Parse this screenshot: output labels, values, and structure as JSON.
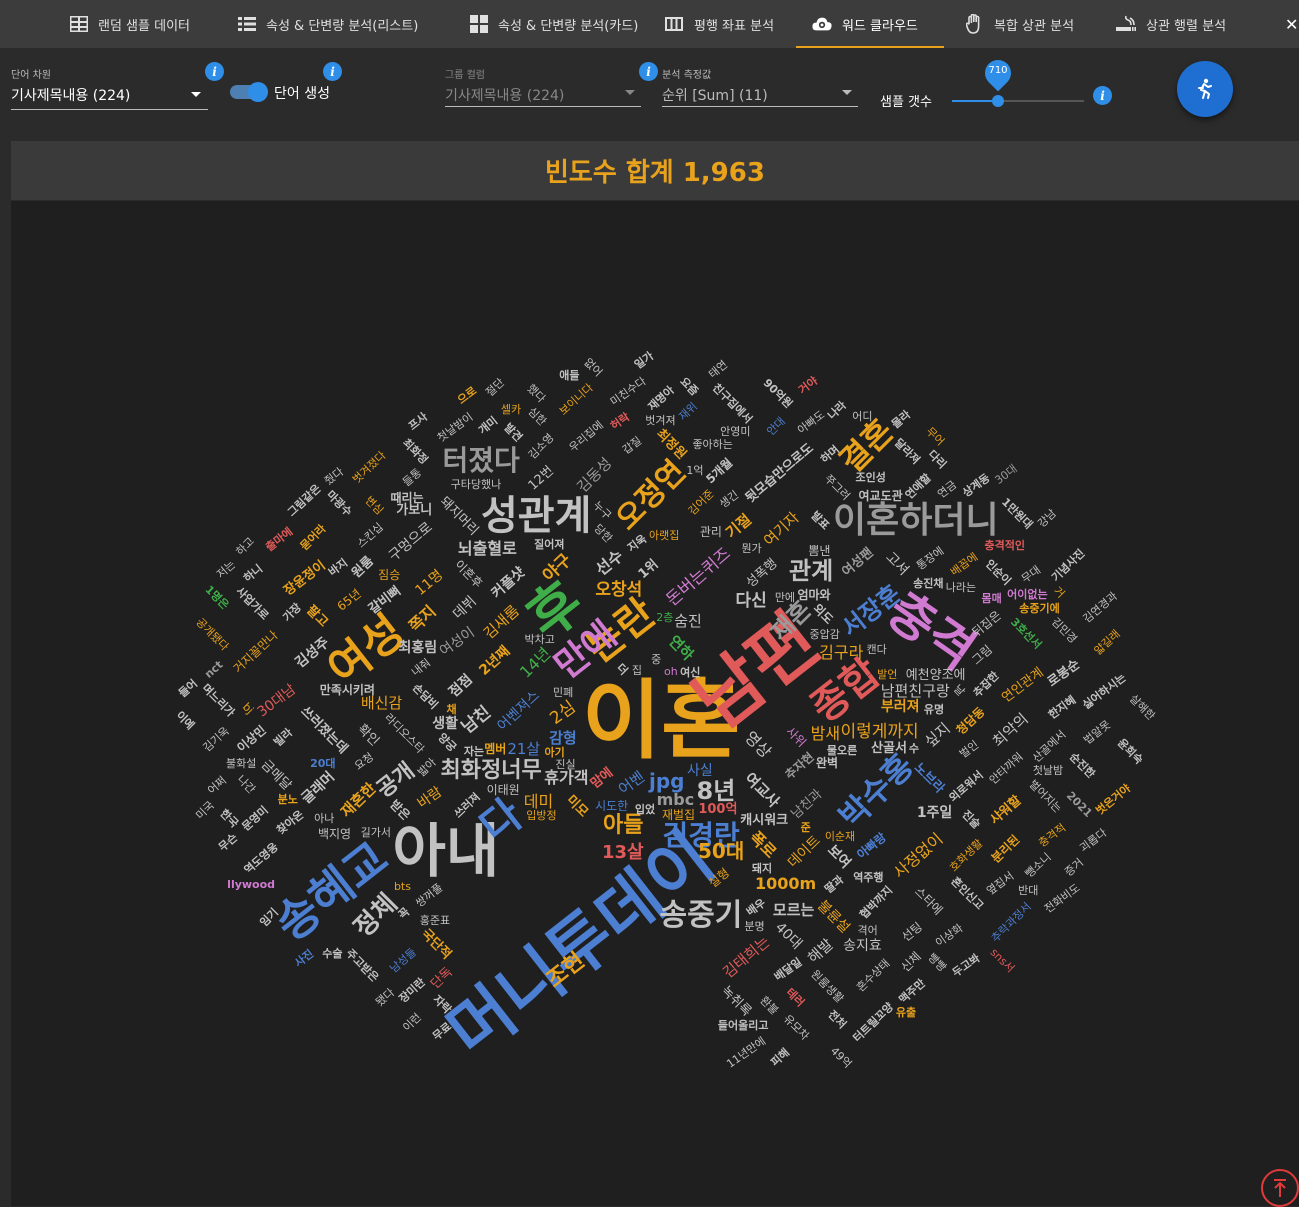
{
  "tabs": [
    {
      "label": "랜덤 샘플 데이터",
      "icon": "table-icon"
    },
    {
      "label": "속성 & 단변량 분석(리스트)",
      "icon": "list-icon"
    },
    {
      "label": "속성 & 단변량 분석(카드)",
      "icon": "grid-icon"
    },
    {
      "label": "평행 좌표 분석",
      "icon": "columns-icon"
    },
    {
      "label": "워드 클라우드",
      "icon": "cloud-icon",
      "active": true
    },
    {
      "label": "복합 상관 분석",
      "icon": "hand-icon"
    },
    {
      "label": "상관 행렬 분석",
      "icon": "smoking-icon"
    }
  ],
  "controls": {
    "word_dim": {
      "label": "단어 차원",
      "value": "기사제목내용 (224)"
    },
    "word_gen": {
      "label": "단어 생성",
      "on": true
    },
    "group_col": {
      "label": "그룹 컬럼",
      "value": "기사제목내용 (224)"
    },
    "measure": {
      "label": "분석 측정값",
      "value": "순위 [Sum] (11)"
    },
    "sample": {
      "label": "샘플 갯수",
      "value": "710",
      "fraction": 0.35
    }
  },
  "panel": {
    "title": "빈도수 합계 1,963"
  },
  "colors": {
    "accent": "#e8a21c",
    "primary": "#2f8ee8"
  },
  "cloud_words": [
    {
      "t": "이혼",
      "c": "#e8a21c"
    },
    {
      "t": "남편",
      "c": "#e05a5a"
    },
    {
      "t": "머니투데이",
      "c": "#4c7fd1"
    },
    {
      "t": "아내",
      "c": "#c2c2c2"
    },
    {
      "t": "송혜교",
      "c": "#4c7fd1"
    },
    {
      "t": "후",
      "c": "#3fae49"
    },
    {
      "t": "충격",
      "c": "#d17ad1"
    },
    {
      "t": "성관계",
      "c": "#c2c2c2"
    },
    {
      "t": "여성",
      "c": "#e8a21c"
    },
    {
      "t": "논란",
      "c": "#e8a21c"
    },
    {
      "t": "만에",
      "c": "#d17ad1"
    },
    {
      "t": "종합",
      "c": "#e05a5a"
    },
    {
      "t": "이혼하더니",
      "c": "#9a9a9a"
    },
    {
      "t": "결혼",
      "c": "#e8a21c"
    },
    {
      "t": "공개",
      "c": "#c2c2c2"
    },
    {
      "t": "오정연",
      "c": "#e8a21c"
    },
    {
      "t": "터졌다",
      "c": "#9a9a9a"
    },
    {
      "t": "김경란",
      "c": "#4c7fd1"
    },
    {
      "t": "송중기",
      "c": "#c2c2c2"
    },
    {
      "t": "박수홍",
      "c": "#4c7fd1"
    },
    {
      "t": "다",
      "c": "#4c7fd1"
    },
    {
      "t": "정체",
      "c": "#c2c2c2"
    },
    {
      "t": "조현",
      "c": "#e8a21c"
    },
    {
      "t": "서장훈",
      "c": "#4c7fd1"
    },
    {
      "t": "관계",
      "c": "#c2c2c2"
    },
    {
      "t": "재혼",
      "c": "#9a9a9a"
    },
    {
      "t": "최화정너무",
      "c": "#c2c2c2"
    },
    {
      "t": "아들",
      "c": "#e8a21c"
    },
    {
      "t": "8년",
      "c": "#c2c2c2"
    },
    {
      "t": "50대",
      "c": "#e8a21c"
    },
    {
      "t": "13살",
      "c": "#e05a5a"
    },
    {
      "t": "jpg",
      "c": "#4c7fd1"
    },
    {
      "t": "연하",
      "c": "#3fae49"
    },
    {
      "t": "어벤",
      "c": "#4c7fd1"
    },
    {
      "t": "mbc",
      "c": "#9a9a9a"
    },
    {
      "t": "영상",
      "c": "#c2c2c2"
    },
    {
      "t": "2심",
      "c": "#e8a21c"
    },
    {
      "t": "여교사",
      "c": "#c2c2c2"
    },
    {
      "t": "어벤져스",
      "c": "#4c7fd1"
    },
    {
      "t": "휴가객",
      "c": "#c2c2c2"
    },
    {
      "t": "14년",
      "c": "#3fae49"
    },
    {
      "t": "사위",
      "c": "#d17ad1"
    },
    {
      "t": "미모",
      "c": "#e8a21c"
    },
    {
      "t": "돈버는퀴즈",
      "c": "#d17ad1"
    },
    {
      "t": "추자현",
      "c": "#9a9a9a"
    },
    {
      "t": "캐시워크",
      "c": "#c2c2c2"
    },
    {
      "t": "남친과",
      "c": "#9a9a9a"
    },
    {
      "t": "시도한",
      "c": "#4c7fd1"
    },
    {
      "t": "2년째",
      "c": "#e8a21c"
    },
    {
      "t": "감형",
      "c": "#4c7fd1"
    },
    {
      "t": "남친",
      "c": "#c2c2c2"
    },
    {
      "t": "집",
      "c": "#c2c2c2"
    },
    {
      "t": "오창석",
      "c": "#e8a21c"
    },
    {
      "t": "데미",
      "c": "#e8a21c"
    },
    {
      "t": "폭로",
      "c": "#e8a21c"
    },
    {
      "t": "이렇게까지",
      "c": "#e8a21c"
    },
    {
      "t": "점점",
      "c": "#c2c2c2"
    },
    {
      "t": "김새롬",
      "c": "#e8a21c"
    },
    {
      "t": "선수",
      "c": "#c2c2c2"
    },
    {
      "t": "다신",
      "c": "#c2c2c2"
    },
    {
      "t": "사실",
      "c": "#4c7fd1"
    },
    {
      "t": "1위",
      "c": "#c2c2c2"
    },
    {
      "t": "야구",
      "c": "#e8a21c"
    },
    {
      "t": "성폭행",
      "c": "#c2c2c2"
    },
    {
      "t": "데이트",
      "c": "#e8a21c"
    },
    {
      "t": "생활",
      "c": "#c2c2c2"
    },
    {
      "t": "실형",
      "c": "#e8a21c"
    },
    {
      "t": "민폐",
      "c": "#c2c2c2"
    },
    {
      "t": "여성이",
      "c": "#9a9a9a"
    },
    {
      "t": "21살",
      "c": "#4c7fd1"
    },
    {
      "t": "외도",
      "c": "#c2c2c2"
    },
    {
      "t": "라디오스타",
      "c": "#c2c2c2"
    },
    {
      "t": "1000m",
      "c": "#e8a21c"
    },
    {
      "t": "커플샷",
      "c": "#c2c2c2"
    },
    {
      "t": "남편친구랑",
      "c": "#c2c2c2"
    },
    {
      "t": "보여",
      "c": "#c2c2c2"
    },
    {
      "t": "손담비",
      "c": "#c2c2c2"
    },
    {
      "t": "기절",
      "c": "#e8a21c"
    },
    {
      "t": "김구라",
      "c": "#e8a21c"
    },
    {
      "t": "쪽지",
      "c": "#e8a21c"
    },
    {
      "t": "뇌출혈로",
      "c": "#c2c2c2"
    },
    {
      "t": "여기자",
      "c": "#e8a21c"
    },
    {
      "t": "숨진",
      "c": "#c2c2c2"
    },
    {
      "t": "아기",
      "c": "#e8a21c"
    },
    {
      "t": "밤새",
      "c": "#e8a21c"
    },
    {
      "t": "데뷔",
      "c": "#c2c2c2"
    },
    {
      "t": "이혼후",
      "c": "#c2c2c2"
    },
    {
      "t": "멤버",
      "c": "#e8a21c"
    },
    {
      "t": "노브라",
      "c": "#4c7fd1"
    },
    {
      "t": "재벌집",
      "c": "#e8a21c"
    },
    {
      "t": "사정없이",
      "c": "#e8a21c"
    },
    {
      "t": "지욱",
      "c": "#c2c2c2"
    },
    {
      "t": "쓰러져",
      "c": "#c2c2c2"
    },
    {
      "t": "바람",
      "c": "#e8a21c"
    },
    {
      "t": "여성팬",
      "c": "#9a9a9a"
    },
    {
      "t": "11명",
      "c": "#e8a21c"
    },
    {
      "t": "100억",
      "c": "#e05a5a"
    },
    {
      "t": "확인",
      "c": "#c2c2c2"
    },
    {
      "t": "싶지",
      "c": "#c2c2c2"
    },
    {
      "t": "김어준",
      "c": "#e8a21c"
    },
    {
      "t": "입방정",
      "c": "#e8a21c"
    },
    {
      "t": "불륜설",
      "c": "#e8a21c"
    },
    {
      "t": "최홍림",
      "c": "#c2c2c2"
    },
    {
      "t": "청담동",
      "c": "#e8a21c"
    },
    {
      "t": "김태희는",
      "c": "#e05a5a"
    },
    {
      "t": "외로워서",
      "c": "#c2c2c2"
    },
    {
      "t": "재혼한",
      "c": "#e8a21c"
    },
    {
      "t": "갈비뼈",
      "c": "#c2c2c2"
    },
    {
      "t": "이순재",
      "c": "#e8a21c"
    },
    {
      "t": "고셔",
      "c": "#c2c2c2"
    },
    {
      "t": "쓰러졌는데",
      "c": "#c2c2c2"
    },
    {
      "t": "부러져",
      "c": "#e8a21c"
    },
    {
      "t": "모르는",
      "c": "#c2c2c2"
    },
    {
      "t": "구멍으로",
      "c": "#c2c2c2"
    },
    {
      "t": "배신감",
      "c": "#e8a21c"
    },
    {
      "t": "쌍꺼풀",
      "c": "#c2c2c2"
    },
    {
      "t": "질어져",
      "c": "#c2c2c2"
    },
    {
      "t": "예천양조에",
      "c": "#c2c2c2"
    },
    {
      "t": "돼지머리",
      "c": "#c2c2c2"
    },
    {
      "t": "아빠랑",
      "c": "#4c7fd1"
    },
    {
      "t": "뒷모습만으로도",
      "c": "#c2c2c2"
    },
    {
      "t": "양궁",
      "c": "#c2c2c2"
    },
    {
      "t": "1주일",
      "c": "#c2c2c2"
    },
    {
      "t": "김동성",
      "c": "#9a9a9a"
    },
    {
      "t": "추잡한",
      "c": "#c2c2c2"
    },
    {
      "t": "협박까지",
      "c": "#c2c2c2"
    },
    {
      "t": "5개월",
      "c": "#c2c2c2"
    },
    {
      "t": "뒤집은",
      "c": "#c2c2c2"
    },
    {
      "t": "통장에",
      "c": "#c2c2c2"
    },
    {
      "t": "최악의",
      "c": "#c2c2c2"
    },
    {
      "t": "이태원",
      "c": "#c2c2c2"
    },
    {
      "t": "40대",
      "c": "#c2c2c2"
    },
    {
      "t": "12번",
      "c": "#c2c2c2"
    },
    {
      "t": "해발",
      "c": "#c2c2c2"
    },
    {
      "t": "안타까워",
      "c": "#c2c2c2"
    },
    {
      "t": "쭈그려",
      "c": "#c2c2c2"
    },
    {
      "t": "중압감",
      "c": "#c2c2c2"
    },
    {
      "t": "발표",
      "c": "#c2c2c2"
    },
    {
      "t": "샤워할",
      "c": "#e8a21c"
    },
    {
      "t": "글래머",
      "c": "#c2c2c2"
    },
    {
      "t": "맘에",
      "c": "#e05a5a"
    },
    {
      "t": "김성주",
      "c": "#c2c2c2"
    },
    {
      "t": "송지효",
      "c": "#c2c2c2"
    },
    {
      "t": "스타에",
      "c": "#c2c2c2"
    },
    {
      "t": "팔고",
      "c": "#e8a21c"
    },
    {
      "t": "갑질",
      "c": "#c2c2c2"
    },
    {
      "t": "관리",
      "c": "#c2c2c2"
    },
    {
      "t": "배꼽에",
      "c": "#e8a21c"
    },
    {
      "t": "밟아",
      "c": "#c2c2c2"
    },
    {
      "t": "호화생활",
      "c": "#e8a21c"
    },
    {
      "t": "3호선서",
      "c": "#3fae49"
    },
    {
      "t": "30대남",
      "c": "#e05a5a"
    },
    {
      "t": "만족시키려",
      "c": "#c2c2c2"
    },
    {
      "t": "연인관계",
      "c": "#e8a21c"
    },
    {
      "t": "국단적",
      "c": "#e8a21c"
    },
    {
      "t": "진실",
      "c": "#c2c2c2"
    },
    {
      "t": "원룸",
      "c": "#c2c2c2"
    },
    {
      "t": "최정원",
      "c": "#e8a21c"
    },
    {
      "t": "65년",
      "c": "#e8a21c"
    },
    {
      "t": "녹취록",
      "c": "#c2c2c2"
    },
    {
      "t": "선팅",
      "c": "#c2c2c2"
    },
    {
      "t": "산골에서",
      "c": "#c2c2c2"
    },
    {
      "t": "박차고",
      "c": "#c2c2c2"
    },
    {
      "t": "요청",
      "c": "#c2c2c2"
    },
    {
      "t": "원룸생활",
      "c": "#c2c2c2"
    },
    {
      "t": "백지영",
      "c": "#c2c2c2"
    },
    {
      "t": "분리된",
      "c": "#e8a21c"
    },
    {
      "t": "구타당했나",
      "c": "#c2c2c2"
    },
    {
      "t": "물오른",
      "c": "#c2c2c2"
    },
    {
      "t": "금메달",
      "c": "#c2c2c2"
    },
    {
      "t": "산골서",
      "c": "#c2c2c2"
    },
    {
      "t": "혼인신고",
      "c": "#c2c2c2"
    },
    {
      "t": "우리집에",
      "c": "#c2c2c2"
    },
    {
      "t": "벌인",
      "c": "#c2c2c2"
    },
    {
      "t": "장윤정이",
      "c": "#e8a21c"
    },
    {
      "t": "여교도관",
      "c": "#c2c2c2"
    },
    {
      "t": "엄마와",
      "c": "#c2c2c2"
    },
    {
      "t": "가보니",
      "c": "#c2c2c2"
    },
    {
      "t": "인순이",
      "c": "#c2c2c2"
    },
    {
      "t": "받은",
      "c": "#c2c2c2"
    },
    {
      "t": "완벽",
      "c": "#c2c2c2"
    },
    {
      "t": "배우",
      "c": "#c2c2c2"
    },
    {
      "t": "내줘",
      "c": "#c2c2c2"
    },
    {
      "t": "좋아하는",
      "c": "#c2c2c2"
    },
    {
      "t": "혼수상태",
      "c": "#c2c2c2"
    },
    {
      "t": "스킨십",
      "c": "#c2c2c2"
    },
    {
      "t": "남성들",
      "c": "#4c7fd1"
    },
    {
      "t": "뽐낸",
      "c": "#c2c2c2"
    },
    {
      "t": "누구",
      "c": "#c2c2c2"
    },
    {
      "t": "딸과",
      "c": "#c2c2c2"
    },
    {
      "t": "찾아온",
      "c": "#c2c2c2"
    },
    {
      "t": "연애할",
      "c": "#c2c2c2"
    },
    {
      "t": "안영미",
      "c": "#c2c2c2"
    },
    {
      "t": "그림",
      "c": "#c2c2c2"
    },
    {
      "t": "때리는",
      "c": "#c2c2c2"
    },
    {
      "t": "아랫집",
      "c": "#e8a21c"
    },
    {
      "t": "캔다",
      "c": "#c2c2c2"
    },
    {
      "t": "테러",
      "c": "#e05a5a"
    },
    {
      "t": "김소영",
      "c": "#c2c2c2"
    },
    {
      "t": "허락",
      "c": "#e05a5a"
    },
    {
      "t": "단독",
      "c": "#e05a5a"
    },
    {
      "t": "벌어지는",
      "c": "#c2c2c2"
    },
    {
      "t": "배달일",
      "c": "#c2c2c2"
    },
    {
      "t": "여신",
      "c": "#c2c2c2"
    },
    {
      "t": "이상화",
      "c": "#c2c2c2"
    },
    {
      "t": "로봉순",
      "c": "#c2c2c2"
    },
    {
      "t": "거지꼴만나",
      "c": "#e8a21c"
    },
    {
      "t": "옆집서",
      "c": "#c2c2c2"
    },
    {
      "t": "벗겨져",
      "c": "#c2c2c2"
    },
    {
      "t": "발견",
      "c": "#c2c2c2"
    },
    {
      "t": "돼지",
      "c": "#c2c2c2"
    },
    {
      "t": "신체",
      "c": "#c2c2c2"
    },
    {
      "t": "진술",
      "c": "#c2c2c2"
    },
    {
      "t": "안대",
      "c": "#4c7fd1"
    },
    {
      "t": "빌라",
      "c": "#c2c2c2"
    },
    {
      "t": "생긴",
      "c": "#c2c2c2"
    },
    {
      "t": "들통",
      "c": "#c2c2c2"
    },
    {
      "t": "무대",
      "c": "#c2c2c2"
    },
    {
      "t": "이상민",
      "c": "#c2c2c2"
    },
    {
      "t": "환불",
      "c": "#c2c2c2"
    },
    {
      "t": "아빠도",
      "c": "#c2c2c2"
    },
    {
      "t": "심한",
      "c": "#c2c2c2"
    },
    {
      "t": "발언",
      "c": "#e8a21c"
    },
    {
      "t": "변심",
      "c": "#e8a21c"
    },
    {
      "t": "재위",
      "c": "#4c7fd1"
    },
    {
      "t": "순진한",
      "c": "#c2c2c2"
    },
    {
      "t": "묻어라",
      "c": "#e8a21c"
    },
    {
      "t": "친구집에서",
      "c": "#c2c2c2"
    },
    {
      "t": "재명아",
      "c": "#c2c2c2"
    },
    {
      "t": "어이없는",
      "c": "#d17ad1"
    },
    {
      "t": "길가서",
      "c": "#c2c2c2"
    },
    {
      "t": "유모차",
      "c": "#c2c2c2"
    },
    {
      "t": "연금",
      "c": "#c2c2c2"
    },
    {
      "t": "송중기에",
      "c": "#e8a21c"
    },
    {
      "t": "한지혜",
      "c": "#c2c2c2"
    },
    {
      "t": "충격적인",
      "c": "#e05a5a"
    },
    {
      "t": "충격적",
      "c": "#e8a21c"
    },
    {
      "t": "짐승",
      "c": "#e8a21c"
    },
    {
      "t": "조인성",
      "c": "#c2c2c2"
    },
    {
      "t": "들어올리고",
      "c": "#c2c2c2"
    },
    {
      "t": "싫어하시는",
      "c": "#c2c2c2"
    },
    {
      "t": "2021",
      "c": "#9a9a9a"
    },
    {
      "t": "빵빵",
      "c": "#c2c2c2"
    },
    {
      "t": "나간",
      "c": "#c2c2c2"
    },
    {
      "t": "김민경",
      "c": "#c2c2c2"
    },
    {
      "t": "보이니다",
      "c": "#e8a21c"
    },
    {
      "t": "첫날밤",
      "c": "#c2c2c2"
    },
    {
      "t": "분명",
      "c": "#c2c2c2"
    },
    {
      "t": "최화정",
      "c": "#c2c2c2"
    },
    {
      "t": "문영미",
      "c": "#c2c2c2"
    },
    {
      "t": "추락과정서",
      "c": "#4c7fd1"
    },
    {
      "t": "주고받은",
      "c": "#c2c2c2"
    },
    {
      "t": "사업가로",
      "c": "#c2c2c2"
    },
    {
      "t": "맥주만",
      "c": "#c2c2c2"
    },
    {
      "t": "11년만에",
      "c": "#c2c2c2"
    },
    {
      "t": "역도영웅",
      "c": "#c2c2c2"
    },
    {
      "t": "마광수",
      "c": "#c2c2c2"
    },
    {
      "t": "첫날밤이",
      "c": "#c2c2c2"
    },
    {
      "t": "터트릴꼬양",
      "c": "#c2c2c2"
    },
    {
      "t": "뺑소니",
      "c": "#c2c2c2"
    },
    {
      "t": "불화설",
      "c": "#c2c2c2"
    },
    {
      "t": "며느리가",
      "c": "#c2c2c2"
    },
    {
      "t": "미친수다",
      "c": "#c2c2c2"
    },
    {
      "t": "벗겨졌다",
      "c": "#e8a21c"
    },
    {
      "t": "상계동",
      "c": "#c2c2c2"
    },
    {
      "t": "자락",
      "c": "#c2c2c2"
    },
    {
      "t": "출마에",
      "c": "#e05a5a"
    },
    {
      "t": "달라져",
      "c": "#c2c2c2"
    },
    {
      "t": "장미란",
      "c": "#c2c2c2"
    },
    {
      "t": "역주행",
      "c": "#c2c2c2"
    },
    {
      "t": "송진채",
      "c": "#c2c2c2"
    },
    {
      "t": "가장",
      "c": "#c2c2c2"
    },
    {
      "t": "1만원대",
      "c": "#c2c2c2"
    },
    {
      "t": "나라는",
      "c": "#c2c2c2"
    },
    {
      "t": "법알못",
      "c": "#c2c2c2"
    },
    {
      "t": "기념사진",
      "c": "#c2c2c2"
    },
    {
      "t": "김기욱",
      "c": "#c2c2c2"
    },
    {
      "t": "그림같은",
      "c": "#c2c2c2"
    },
    {
      "t": "홍준표",
      "c": "#c2c2c2"
    },
    {
      "t": "90억원",
      "c": "#c2c2c2"
    },
    {
      "t": "괴롭다",
      "c": "#c2c2c2"
    },
    {
      "t": "두고봐",
      "c": "#c2c2c2"
    },
    {
      "t": "한국",
      "c": "#c2c2c2"
    },
    {
      "t": "김연경과",
      "c": "#c2c2c2"
    },
    {
      "t": "나라",
      "c": "#c2c2c2"
    },
    {
      "t": "sns서",
      "c": "#e05a5a"
    },
    {
      "t": "하며",
      "c": "#c2c2c2"
    },
    {
      "t": "윤희숙",
      "c": "#c2c2c2"
    },
    {
      "t": "하니",
      "c": "#c2c2c2"
    },
    {
      "t": "아나",
      "c": "#c2c2c2"
    },
    {
      "t": "요즘",
      "c": "#c2c2c2"
    },
    {
      "t": "전처",
      "c": "#c2c2c2"
    },
    {
      "t": "했다",
      "c": "#c2c2c2"
    },
    {
      "t": "당한",
      "c": "#c2c2c2"
    },
    {
      "t": "증거",
      "c": "#c2c2c2"
    },
    {
      "t": "공개됐다",
      "c": "#e8a21c"
    },
    {
      "t": "피해",
      "c": "#c2c2c2"
    },
    {
      "t": "어디",
      "c": "#c2c2c2"
    },
    {
      "t": "수술",
      "c": "#c2c2c2"
    },
    {
      "t": "프사",
      "c": "#c2c2c2"
    },
    {
      "t": "날",
      "c": "#c2c2c2"
    },
    {
      "t": "줬다",
      "c": "#c2c2c2"
    },
    {
      "t": "자는",
      "c": "#c2c2c2"
    },
    {
      "t": "거",
      "c": "#e8a21c"
    },
    {
      "t": "무슨",
      "c": "#c2c2c2"
    },
    {
      "t": "몰라",
      "c": "#c2c2c2"
    },
    {
      "t": "개미",
      "c": "#c2c2c2"
    },
    {
      "t": "다리",
      "c": "#c2c2c2"
    },
    {
      "t": "이런",
      "c": "#c2c2c2"
    },
    {
      "t": "미국",
      "c": "#c2c2c2"
    },
    {
      "t": "태연",
      "c": "#c2c2c2"
    },
    {
      "t": "없어",
      "c": "#c2c2c2"
    },
    {
      "t": "들어",
      "c": "#c2c2c2"
    },
    {
      "t": "반대",
      "c": "#c2c2c2"
    },
    {
      "t": "만에",
      "c": "#c2c2c2"
    },
    {
      "t": "1억",
      "c": "#c2c2c2"
    },
    {
      "t": "더",
      "c": "#c2c2c2"
    },
    {
      "t": "격어",
      "c": "#c2c2c2"
    },
    {
      "t": "얇길래",
      "c": "#e8a21c"
    },
    {
      "t": "분노",
      "c": "#e8a21c"
    },
    {
      "t": "벗은거야",
      "c": "#e8a21c"
    },
    {
      "t": "30대",
      "c": "#9a9a9a"
    },
    {
      "t": "유출",
      "c": "#e8a21c"
    },
    {
      "t": "바지",
      "c": "#c2c2c2"
    },
    {
      "t": "유명",
      "c": "#c2c2c2"
    },
    {
      "t": "무료",
      "c": "#c2c2c2"
    },
    {
      "t": "20대",
      "c": "#4c7fd1"
    },
    {
      "t": "채",
      "c": "#e8a21c"
    },
    {
      "t": "입었",
      "c": "#c2c2c2"
    },
    {
      "t": "1명은",
      "c": "#3fae49"
    },
    {
      "t": "됐다",
      "c": "#c2c2c2"
    },
    {
      "t": "몸매",
      "c": "#d17ad1"
    },
    {
      "t": "nct",
      "c": "#9a9a9a"
    },
    {
      "t": "어쩌",
      "c": "#c2c2c2"
    },
    {
      "t": "oh",
      "c": "#d17ad1"
    },
    {
      "t": "수",
      "c": "#c2c2c2"
    },
    {
      "t": "강남",
      "c": "#c2c2c2"
    },
    {
      "t": "으로",
      "c": "#e8a21c"
    },
    {
      "t": "준",
      "c": "#e8a21c"
    },
    {
      "t": "꼭",
      "c": "#c2c2c2"
    },
    {
      "t": "뭔가",
      "c": "#c2c2c2"
    },
    {
      "t": "무어",
      "c": "#e8a21c"
    },
    {
      "t": "중",
      "c": "#c2c2c2"
    },
    {
      "t": "llywood",
      "c": "#d17ad1"
    },
    {
      "t": "사진",
      "c": "#4c7fd1"
    },
    {
      "t": "셀카",
      "c": "#e8a21c"
    },
    {
      "t": "임기",
      "c": "#c2c2c2"
    },
    {
      "t": "일가",
      "c": "#c2c2c2"
    },
    {
      "t": "49억",
      "c": "#c2c2c2"
    },
    {
      "t": "이예",
      "c": "#c2c2c2"
    },
    {
      "t": "bts",
      "c": "#e8a21c"
    },
    {
      "t": "bj",
      "c": "#e8a21c"
    },
    {
      "t": "2층",
      "c": "#3fae49"
    },
    {
      "t": "저는",
      "c": "#c2c2c2"
    },
    {
      "t": "전화비도",
      "c": "#c2c2c2"
    },
    {
      "t": "애들",
      "c": "#c2c2c2"
    },
    {
      "t": "거야",
      "c": "#e05a5a"
    },
    {
      "t": "하고",
      "c": "#c2c2c2"
    },
    {
      "t": "절단",
      "c": "#c2c2c2"
    },
    {
      "t": "살해한",
      "c": "#c2c2c2"
    }
  ]
}
